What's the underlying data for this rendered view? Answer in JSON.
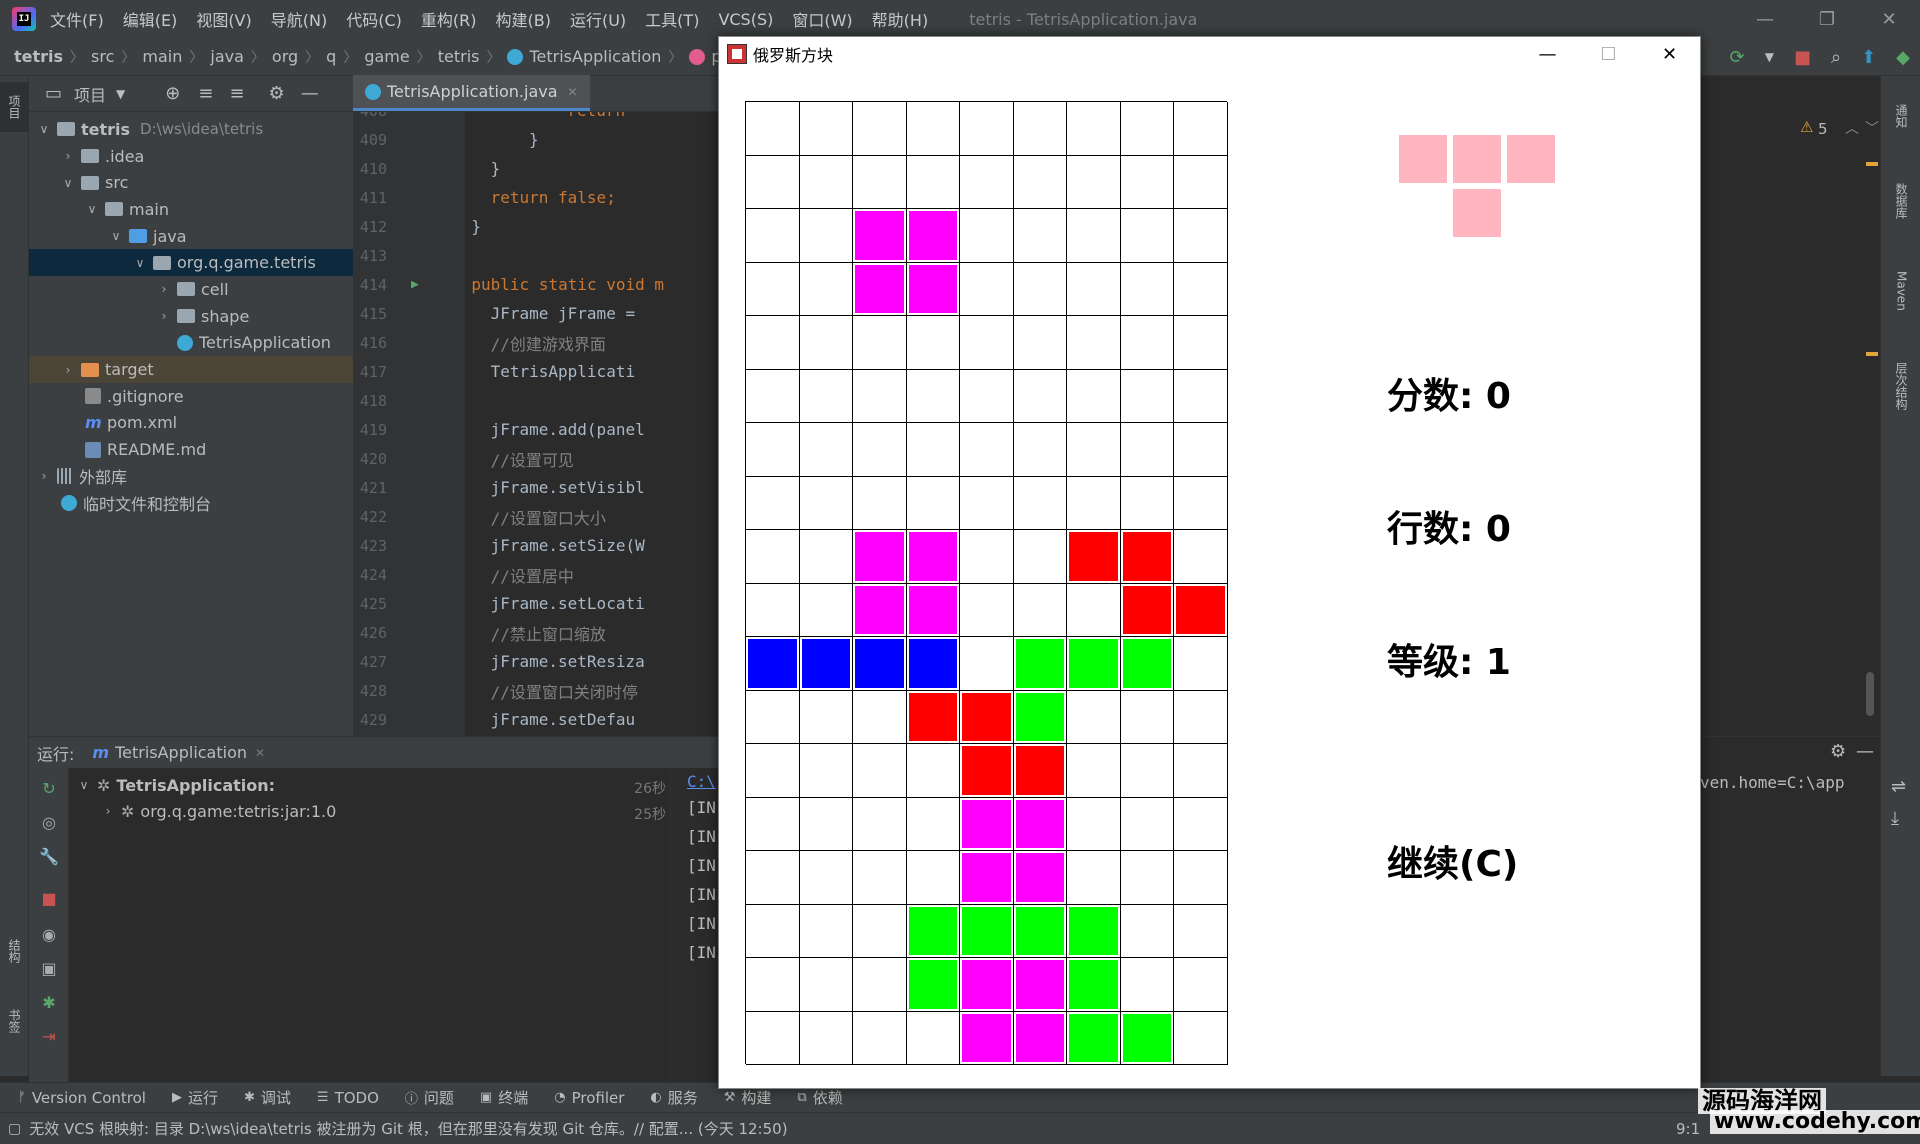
{
  "ide": {
    "menu": [
      "文件(F)",
      "编辑(E)",
      "视图(V)",
      "导航(N)",
      "代码(C)",
      "重构(R)",
      "构建(B)",
      "运行(U)",
      "工具(T)",
      "VCS(S)",
      "窗口(W)",
      "帮助(H)"
    ],
    "window_title": "tetris - TetrisApplication.java",
    "breadcrumb": [
      "tetris",
      "src",
      "main",
      "java",
      "org",
      "q",
      "game",
      "tetris",
      "TetrisApplication",
      "paintWall"
    ],
    "editor_tab": "TetrisApplication.java",
    "project_header": "项目",
    "left_tabs": {
      "project": "项目",
      "structure": "结构",
      "bookmarks": "书签"
    },
    "right_tabs": {
      "notifications": "通知",
      "database": "数据库",
      "maven": "Maven",
      "hierarchy": "层次结构"
    },
    "tree": [
      {
        "label": "tetris",
        "path": "D:\\ws\\idea\\tetris"
      },
      {
        "label": ".idea"
      },
      {
        "label": "src"
      },
      {
        "label": "main"
      },
      {
        "label": "java"
      },
      {
        "label": "org.q.game.tetris"
      },
      {
        "label": "cell"
      },
      {
        "label": "shape"
      },
      {
        "label": "TetrisApplication"
      },
      {
        "label": "target"
      },
      {
        "label": ".gitignore"
      },
      {
        "label": "pom.xml"
      },
      {
        "label": "README.md"
      },
      {
        "label": "外部库"
      },
      {
        "label": "临时文件和控制台"
      }
    ],
    "code_lines": [
      {
        "n": "408",
        "text": "return"
      },
      {
        "n": "409",
        "text": "}"
      },
      {
        "n": "410",
        "text": "}"
      },
      {
        "n": "411",
        "text": "return false;"
      },
      {
        "n": "412",
        "text": "}"
      },
      {
        "n": "413",
        "text": ""
      },
      {
        "n": "414",
        "text": "public static void m"
      },
      {
        "n": "415",
        "text": "JFrame jFrame = "
      },
      {
        "n": "416",
        "text": "//创建游戏界面"
      },
      {
        "n": "417",
        "text": "TetrisApplicati"
      },
      {
        "n": "418",
        "text": ""
      },
      {
        "n": "419",
        "text": "jFrame.add(panel"
      },
      {
        "n": "420",
        "text": "//设置可见"
      },
      {
        "n": "421",
        "text": "jFrame.setVisibl"
      },
      {
        "n": "422",
        "text": "//设置窗口大小"
      },
      {
        "n": "423",
        "text": "jFrame.setSize(W"
      },
      {
        "n": "424",
        "text": "//设置居中"
      },
      {
        "n": "425",
        "text": "jFrame.setLocati"
      },
      {
        "n": "426",
        "text": "//禁止窗口缩放"
      },
      {
        "n": "427",
        "text": "jFrame.setResiza"
      },
      {
        "n": "428",
        "text": "//设置窗口关闭时停"
      },
      {
        "n": "429",
        "text": "jFrame.setDefau"
      }
    ],
    "warnings": "5",
    "run": {
      "label": "运行:",
      "config": "TetrisApplication",
      "tree": [
        {
          "label": "TetrisApplication:",
          "time": "26秒"
        },
        {
          "label": "org.q.game:tetris:jar:1.0",
          "time": "25秒"
        }
      ],
      "console": [
        "C:\\",
        "[IN",
        "[IN",
        "[IN",
        "[IN",
        "[IN",
        "[IN"
      ],
      "console_right": "ven.home=C:\\app"
    },
    "tool_tabs": [
      "Version Control",
      "运行",
      "调试",
      "TODO",
      "问题",
      "终端",
      "Profiler",
      "服务",
      "构建",
      "依赖"
    ],
    "status": "无效 VCS 根映射: 目录 D:\\ws\\idea\\tetris 被注册为 Git 根，但在那里没有发现 Git 仓库。// 配置... (今天 12:50)",
    "status_pos": "9:1"
  },
  "game": {
    "title": "俄罗斯方块",
    "rows": 18,
    "cols": 9,
    "colors": {
      "M": "#ff00ff",
      "R": "#ff0000",
      "B": "#0000ff",
      "G": "#00ff00",
      "next": "#ffb6c1"
    },
    "grid": [
      ".........",
      ".........",
      "..MM.....",
      "..MM.....",
      ".........",
      ".........",
      ".........",
      ".........",
      "..MM..RR.",
      "..MM...RR",
      "BBBB.GGG.",
      "...RRG...",
      "....RR...",
      "....MM...",
      "....MM...",
      "...GGGG..",
      "...GMMG..",
      "....MMGG."
    ],
    "next_piece": [
      [
        0,
        0
      ],
      [
        1,
        0
      ],
      [
        2,
        0
      ],
      [
        1,
        1
      ]
    ],
    "score_label": "分数: 0",
    "lines_label": "行数: 0",
    "level_label": "等级: 1",
    "status_label": "继续(C)"
  },
  "watermark": {
    "line1": "源码海洋网",
    "line2": "www.codehy.com"
  }
}
